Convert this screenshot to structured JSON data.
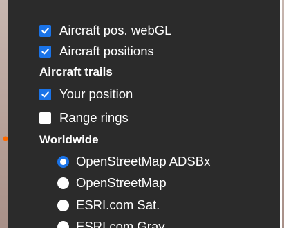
{
  "panel": {
    "items": [
      {
        "type": "checkbox",
        "label": "Aircraft pos. webGL",
        "checked": true
      },
      {
        "type": "checkbox",
        "label": "Aircraft positions",
        "checked": true
      }
    ],
    "trails_heading": "Aircraft trails",
    "trails_items": [
      {
        "type": "checkbox",
        "label": "Your position",
        "checked": true
      },
      {
        "type": "checkbox",
        "label": "Range rings",
        "checked": false
      }
    ],
    "worldwide_heading": "Worldwide",
    "worldwide_items": [
      {
        "type": "radio",
        "label": "OpenStreetMap ADSBx",
        "selected": true
      },
      {
        "type": "radio",
        "label": "OpenStreetMap",
        "selected": false
      },
      {
        "type": "radio",
        "label": "ESRI.com Sat.",
        "selected": false
      },
      {
        "type": "radio",
        "label": "ESRI.com Gray",
        "selected": false
      }
    ]
  },
  "colors": {
    "panel_bg": "#2b2b2b",
    "accent": "#1a73e8",
    "text": "#ffffff"
  }
}
